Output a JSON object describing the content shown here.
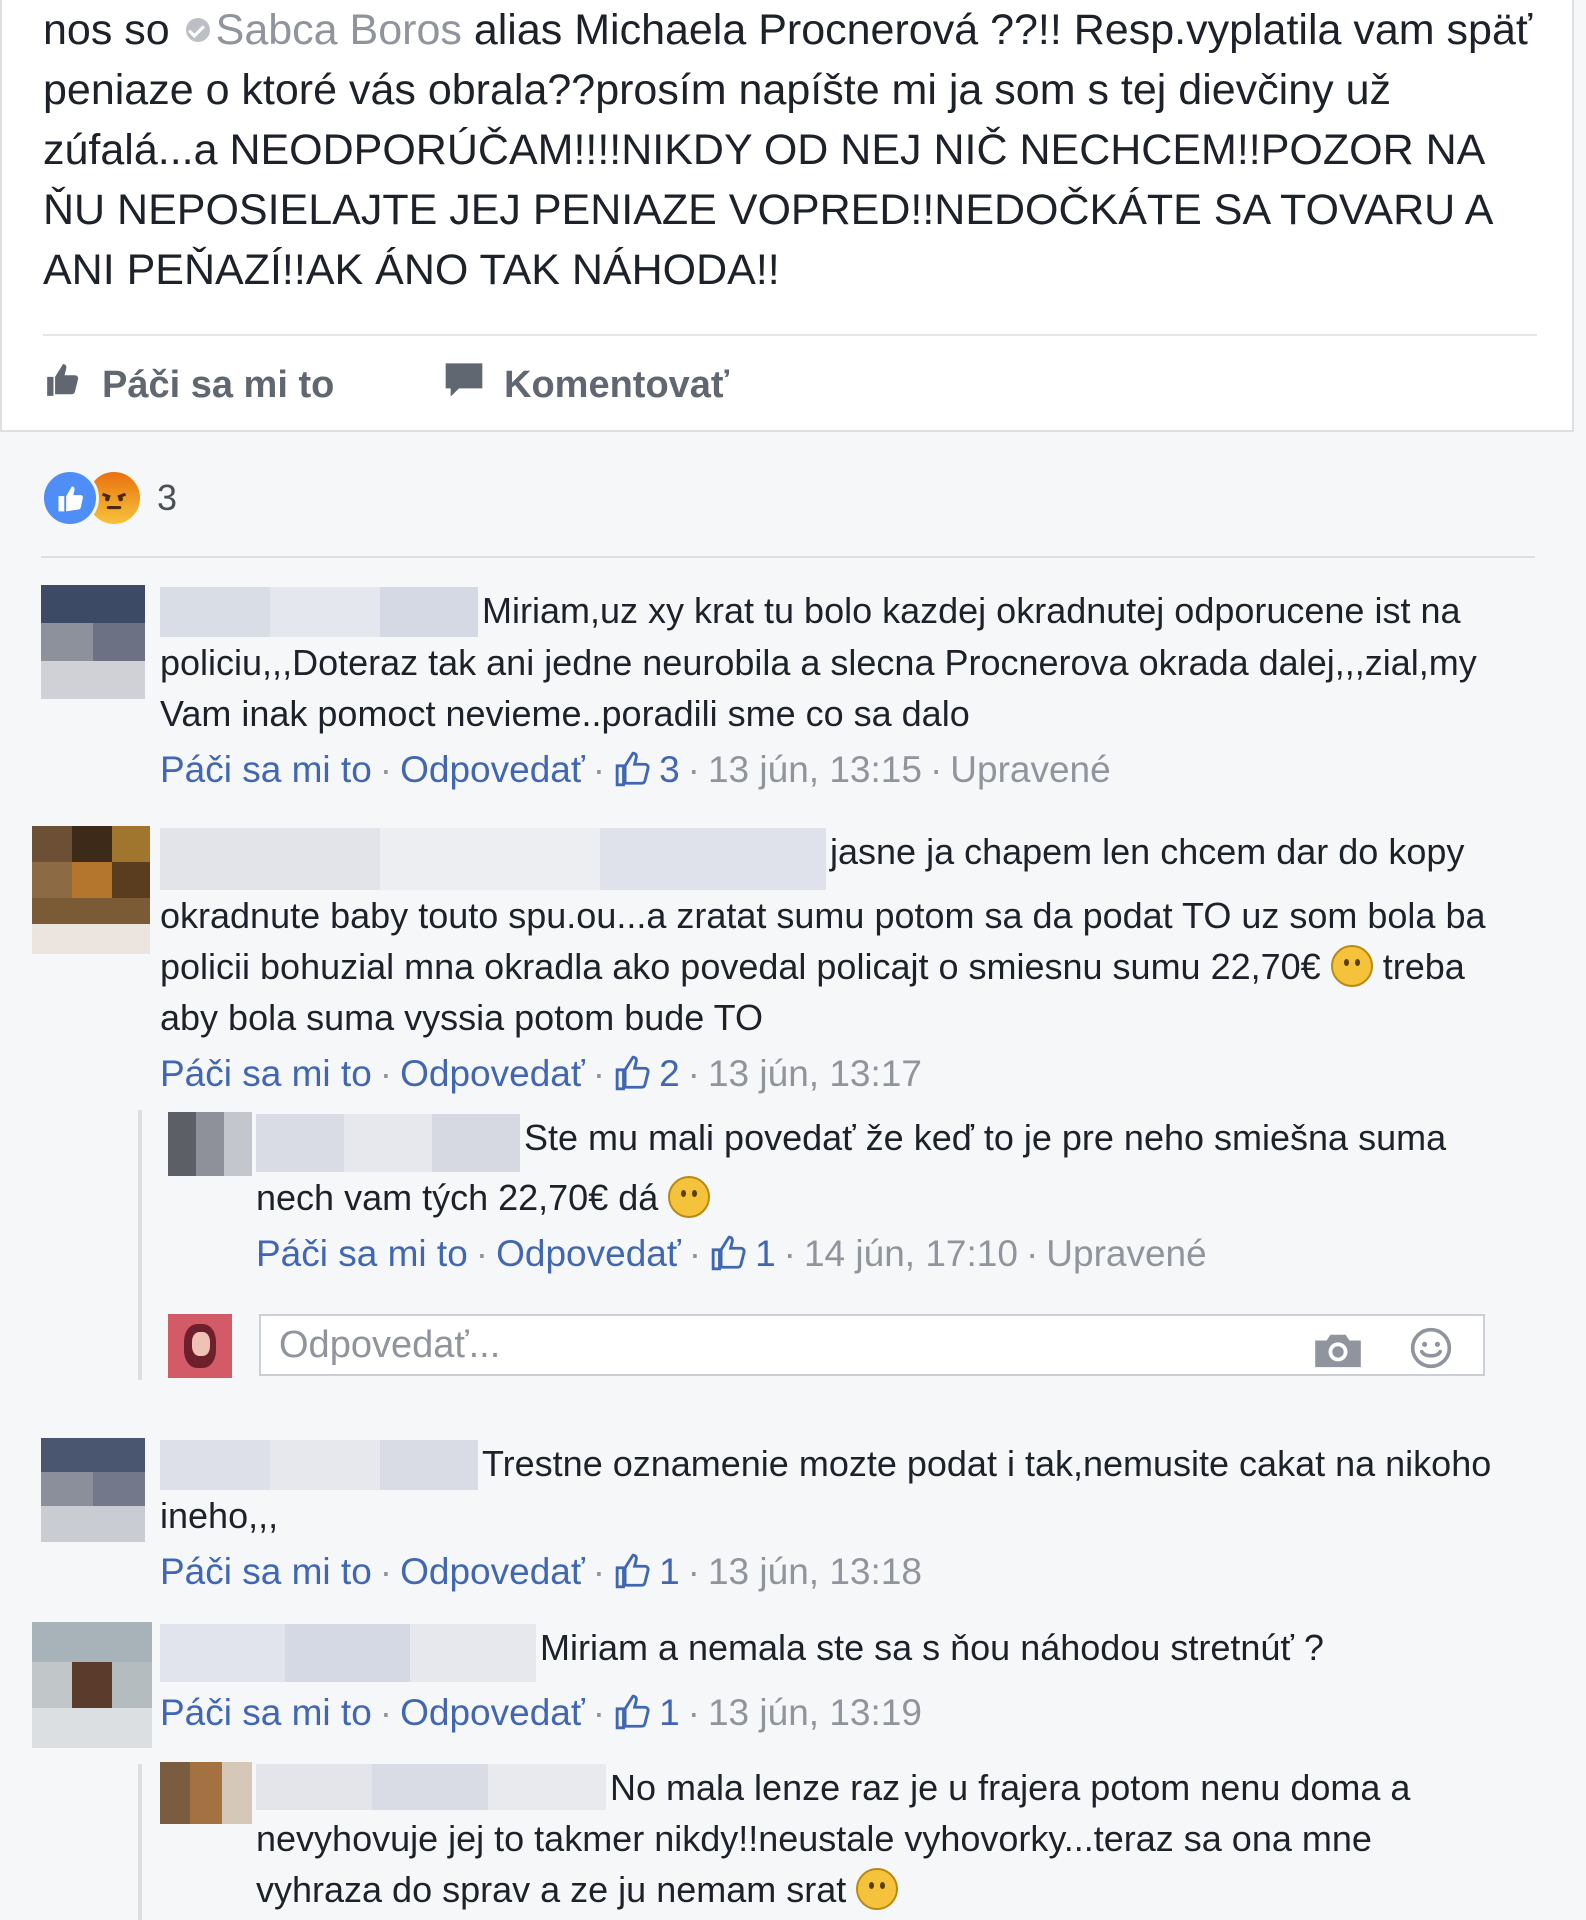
{
  "post": {
    "text_before": "nos so",
    "author": "Sabca Boros",
    "text_after": "alias Michaela Procnerová ??!! Resp.vyplatila vam späť peniaze o ktoré vás obrala??prosím napíšte mi ja som s tej dievčiny už zúfalá...a NEODPORÚČAM!!!!NIKDY OD NEJ NIČ NECHCEM!!POZOR NA ŇU NEPOSIELAJTE JEJ PENIAZE VOPRED!!NEDOČKÁTE SA TOVARU A ANI PEŇAZÍ!!AK ÁNO TAK NÁHODA!!",
    "like_label": "Páči sa mi to",
    "comment_label": "Komentovať"
  },
  "reactions": {
    "count": "3",
    "icons": [
      "like-reaction-icon",
      "angry-reaction-icon"
    ]
  },
  "comments": [
    {
      "text": "Miriam,uz xy krat tu bolo kazdej okradnutej odporucene ist na policiu,,,Doteraz tak ani jedne neurobila a slecna Procnerova okrada dalej,,,zial,my Vam inak pomoct nevieme..poradili sme co sa dalo",
      "like": "Páči sa mi to",
      "reply": "Odpovedať",
      "likes": "3",
      "time": "13 jún, 13:15",
      "edited": "Upravené"
    },
    {
      "text_1": "jasne ja chapem len chcem dar do kopy okradnute baby touto spu.ou...a zratat sumu potom sa da podat TO uz som bola ba policii bohuzial mna okradla ako povedal policajt o smiesnu sumu 22,70€",
      "text_2": "treba aby bola suma vyssia potom bude TO",
      "like": "Páči sa mi to",
      "reply": "Odpovedať",
      "likes": "2",
      "time": "13 jún, 13:17"
    },
    {
      "text": "Ste mu mali povedať že keď to je pre neho smiešna suma nech vam tých 22,70€ dá",
      "like": "Páči sa mi to",
      "reply": "Odpovedať",
      "likes": "1",
      "time": "14 jún, 17:10",
      "edited": "Upravené"
    },
    {
      "text": "Trestne oznamenie mozte podat i tak,nemusite cakat na nikoho ineho,,,",
      "like": "Páči sa mi to",
      "reply": "Odpovedať",
      "likes": "1",
      "time": "13 jún, 13:18"
    },
    {
      "text": "Miriam a nemala ste sa s ňou náhodou stretnúť ?",
      "like": "Páči sa mi to",
      "reply": "Odpovedať",
      "likes": "1",
      "time": "13 jún, 13:19"
    },
    {
      "text": "No mala lenze raz je u frajera potom nenu doma a nevyhovuje jej to takmer nikdy!!neustale vyhovorky...teraz sa ona mne vyhraza do sprav a ze ju nemam srat"
    }
  ],
  "reply_box": {
    "placeholder": "Odpovedať...",
    "icons": [
      "camera-icon",
      "emoji-icon"
    ]
  },
  "colors": {
    "link": "#4267b2",
    "meta": "#90949c",
    "text": "#1d2129",
    "like_reaction": "#4f8ef7"
  }
}
